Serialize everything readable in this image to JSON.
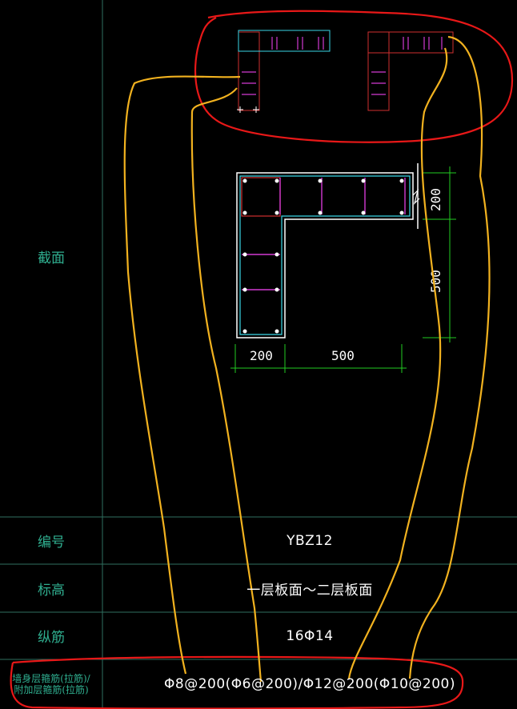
{
  "table": {
    "section_label": "截面",
    "rows": [
      {
        "label": "编号",
        "value": "YBZ12"
      },
      {
        "label": "标高",
        "value": "一层板面～二层板面"
      },
      {
        "label": "纵筋",
        "value": "16Φ14"
      }
    ],
    "stirrup_row": {
      "label_line1": "墙身层箍筋(拉筋)/",
      "label_line2": "附加层箍筋(拉筋)",
      "value": "Φ8@200(Φ6@200)/Φ12@200(Φ10@200)"
    }
  },
  "drawing": {
    "dimensions": {
      "top_right_vertical": "200",
      "right_vertical": "500",
      "bottom_left": "200",
      "bottom_right": "500"
    }
  },
  "colors": {
    "background": "#000000",
    "grid": "#2f6f5f",
    "label_text": "#2fae8f",
    "concrete_outline": "#ffffff",
    "hoop_cyan": "#3ad6e6",
    "rebar_red": "#d03030",
    "tie_magenta": "#d23ad2",
    "dimension_green": "#22cc22",
    "annotation_yellow": "#f2b21f",
    "annotation_red": "#e81818"
  }
}
